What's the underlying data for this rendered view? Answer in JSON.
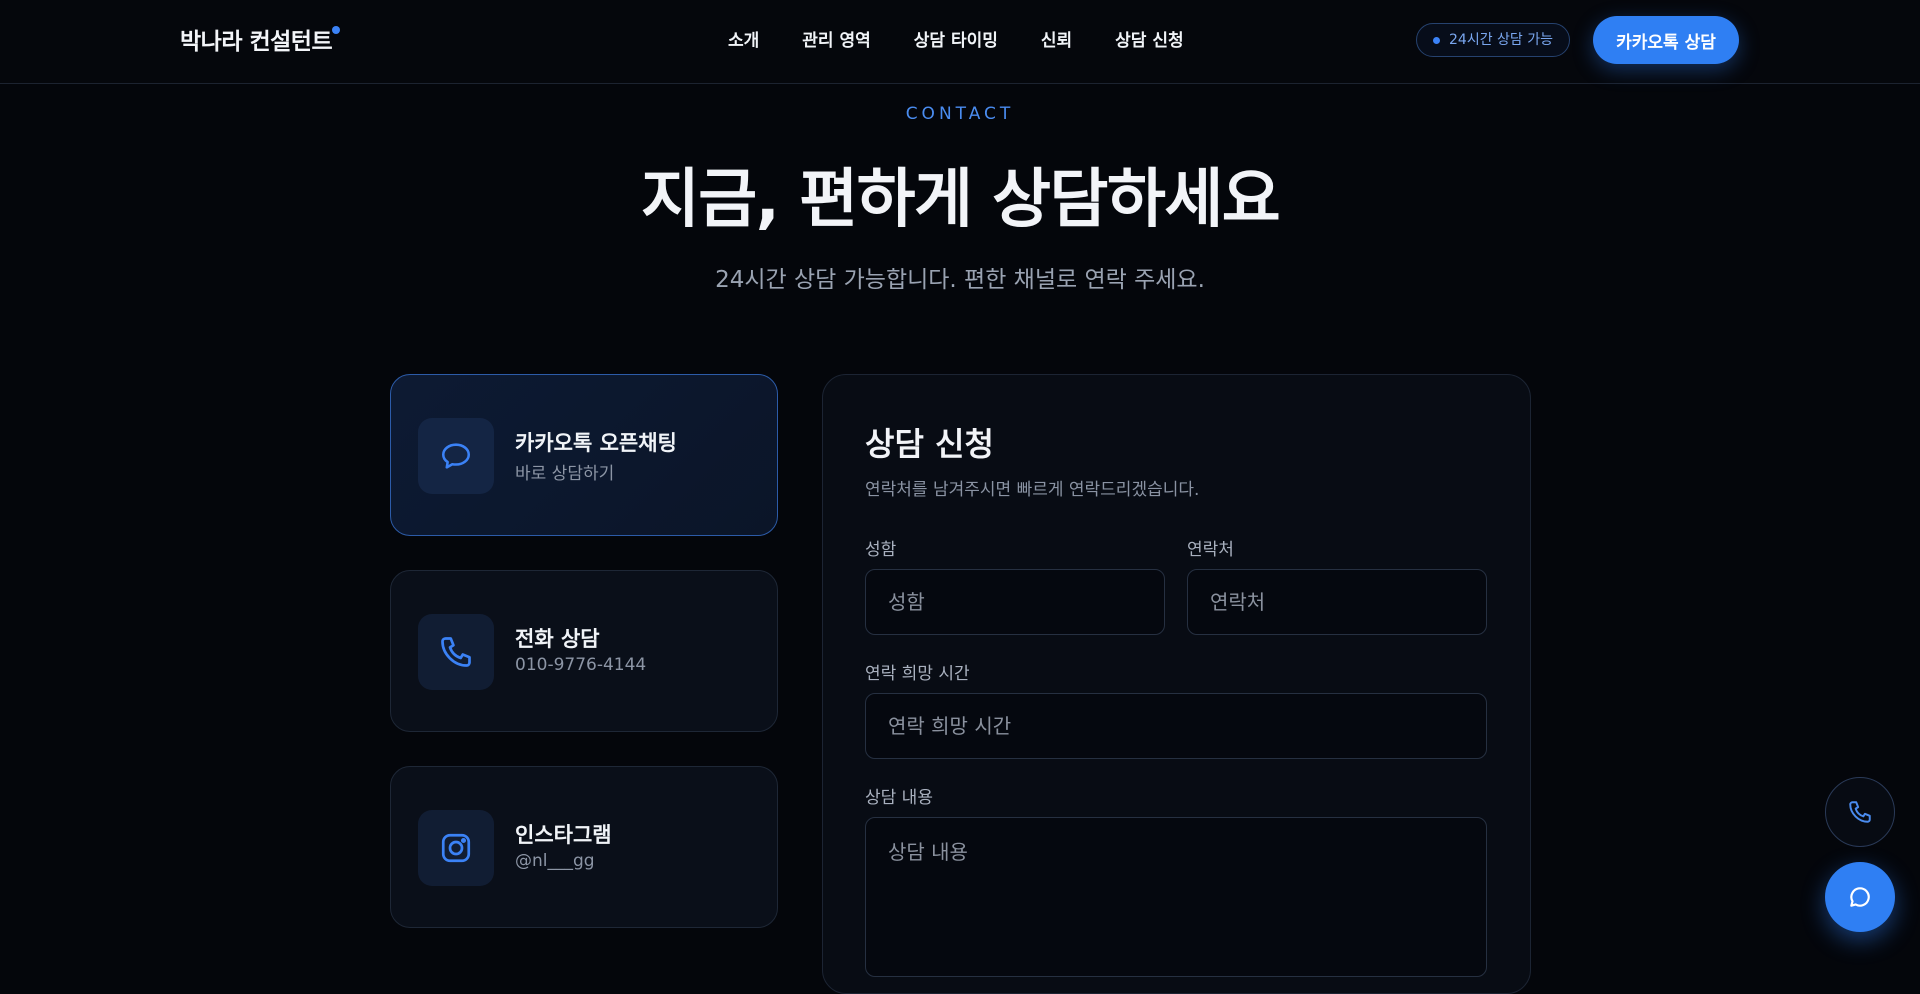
{
  "header": {
    "logo": "박나라 컨설턴트",
    "nav": [
      "소개",
      "관리 영역",
      "상담 타이밍",
      "신뢰",
      "상담 신청"
    ],
    "badge": "24시간 상담 가능",
    "cta": "카카오톡 상담"
  },
  "hero": {
    "eyebrow": "CONTACT",
    "title": "지금, 편하게 상담하세요",
    "subtitle": "24시간 상담 가능합니다. 편한 채널로 연락 주세요."
  },
  "contacts": [
    {
      "title": "카카오톡 오픈채팅",
      "sub": "바로 상담하기",
      "icon": "chat-icon"
    },
    {
      "title": "전화 상담",
      "sub": "010-9776-4144",
      "icon": "phone-icon"
    },
    {
      "title": "인스타그램",
      "sub": "@nl___gg",
      "icon": "instagram-icon"
    }
  ],
  "form": {
    "title": "상담 신청",
    "desc": "연락처를 남겨주시면 빠르게 연락드리겠습니다.",
    "name_label": "성함",
    "name_placeholder": "성함",
    "phone_label": "연락처",
    "phone_placeholder": "연락처",
    "time_label": "연락 희망 시간",
    "time_placeholder": "연락 희망 시간",
    "content_label": "상담 내용",
    "content_placeholder": "상담 내용"
  },
  "colors": {
    "accent": "#2f7ff3",
    "background": "#04060b"
  }
}
